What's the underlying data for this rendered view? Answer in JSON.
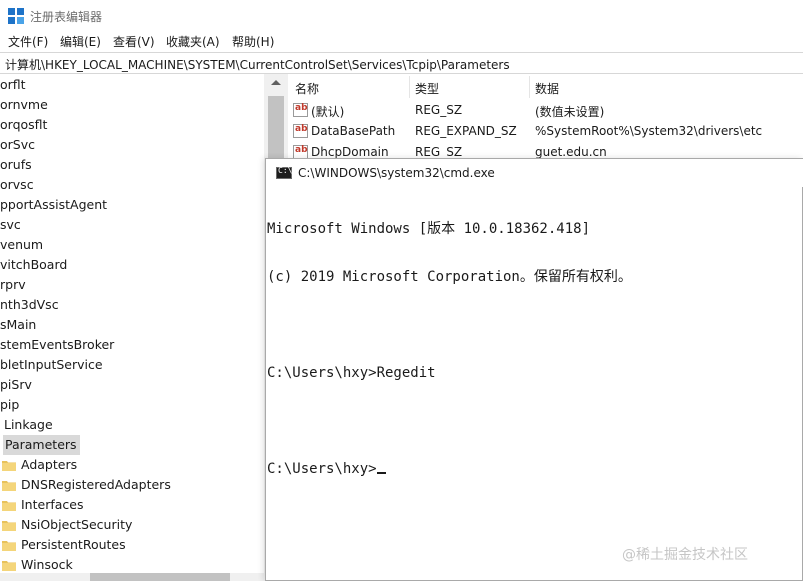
{
  "titlebar": {
    "title": "注册表编辑器"
  },
  "menu": {
    "items": [
      "文件(F)",
      "编辑(E)",
      "查看(V)",
      "收藏夹(A)",
      "帮助(H)"
    ]
  },
  "address": {
    "path": "计算机\\HKEY_LOCAL_MACHINE\\SYSTEM\\CurrentControlSet\\Services\\Tcpip\\Parameters"
  },
  "tree": {
    "items": [
      "orflt",
      "ornvme",
      "orqosflt",
      "orSvc",
      "orufs",
      "orvsc",
      "pportAssistAgent",
      "svc",
      "venum",
      "vitchBoard",
      "rprv",
      "nth3dVsc",
      "sMain",
      "stemEventsBroker",
      "bletInputService",
      "piSrv",
      "pip",
      "Linkage"
    ],
    "selected": "Parameters",
    "children": [
      "Adapters",
      "DNSRegisteredAdapters",
      "Interfaces",
      "NsiObjectSecurity",
      "PersistentRoutes",
      "Winsock"
    ]
  },
  "values": {
    "headers": {
      "name": "名称",
      "type": "类型",
      "data": "数据"
    },
    "rows": [
      {
        "name": "(默认)",
        "type": "REG_SZ",
        "data": "(数值未设置)"
      },
      {
        "name": "DataBasePath",
        "type": "REG_EXPAND_SZ",
        "data": "%SystemRoot%\\System32\\drivers\\etc"
      },
      {
        "name": "DhcpDomain",
        "type": "REG_SZ",
        "data": "guet.edu.cn"
      }
    ]
  },
  "cmd": {
    "title": "C:\\WINDOWS\\system32\\cmd.exe",
    "icon_text": "C:\\",
    "lines": [
      "Microsoft Windows [版本 10.0.18362.418]",
      "(c) 2019 Microsoft Corporation。保留所有权利。",
      "",
      "C:\\Users\\hxy>Regedit",
      "",
      "C:\\Users\\hxy>"
    ]
  },
  "watermark": "@稀土掘金技术社区",
  "colors": {
    "selection": "#d9d9d9",
    "folder": "#e8c25a",
    "icon_red": "#c0392b"
  }
}
